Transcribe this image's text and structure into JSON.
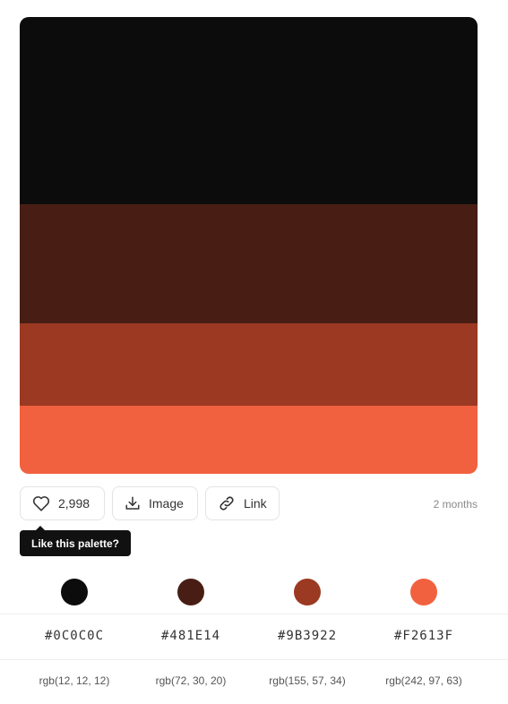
{
  "palette": {
    "colors": [
      {
        "hex_label": "#0C0C0C",
        "rgb_label": "rgb(12, 12, 12)",
        "color": "#0C0C0C"
      },
      {
        "hex_label": "#481E14",
        "rgb_label": "rgb(72, 30, 20)",
        "color": "#481E14"
      },
      {
        "hex_label": "#9B3922",
        "rgb_label": "rgb(155, 57, 34)",
        "color": "#9B3922"
      },
      {
        "hex_label": "#F2613F",
        "rgb_label": "rgb(242, 97, 63)",
        "color": "#F2613F"
      }
    ]
  },
  "actions": {
    "like_count": "2,998",
    "image_label": "Image",
    "link_label": "Link",
    "like_icon": "heart-icon",
    "image_icon": "download-icon",
    "link_icon": "link-icon"
  },
  "timestamp": "2 months",
  "tooltip": "Like this palette?"
}
